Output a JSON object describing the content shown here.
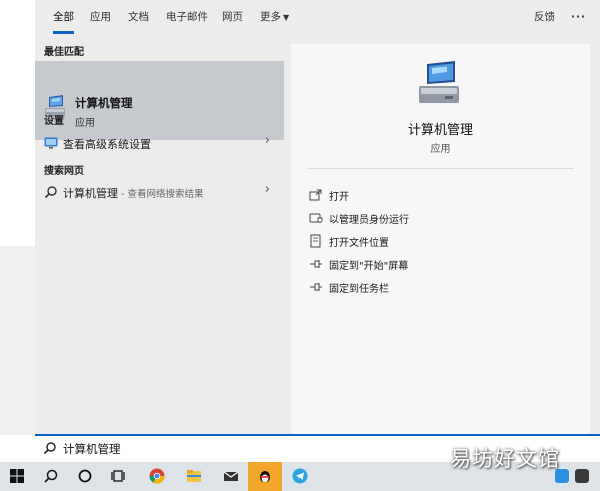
{
  "tabs": [
    {
      "label": "全部"
    },
    {
      "label": "应用"
    },
    {
      "label": "文档"
    },
    {
      "label": "电子邮件"
    },
    {
      "label": "网页"
    },
    {
      "label": "更多"
    }
  ],
  "header": {
    "feedback": "反馈",
    "more_options": "···"
  },
  "best_match": {
    "section": "最佳匹配",
    "title": "计算机管理",
    "subtitle": "应用"
  },
  "settings": {
    "section": "设置",
    "item": "查看高级系统设置"
  },
  "web": {
    "section": "搜索网页",
    "item": "计算机管理",
    "hint": " - 查看网络搜索结果"
  },
  "preview": {
    "title": "计算机管理",
    "subtitle": "应用",
    "actions": [
      {
        "label": "打开",
        "icon": "open-icon"
      },
      {
        "label": "以管理员身份运行",
        "icon": "shield-admin-icon"
      },
      {
        "label": "打开文件位置",
        "icon": "file-location-icon"
      },
      {
        "label": "固定到\"开始\"屏幕",
        "icon": "pin-icon"
      },
      {
        "label": "固定到任务栏",
        "icon": "pin-icon"
      }
    ]
  },
  "search": {
    "value": "计算机管理"
  },
  "watermark": "易坊好文馆",
  "colors": {
    "accent": "#0a64c8",
    "selected": "#c6c9ce",
    "panel": "#ececec",
    "preview": "#f7f7f7"
  }
}
